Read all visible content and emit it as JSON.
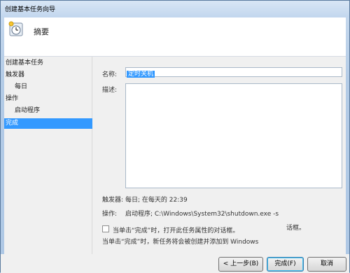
{
  "window": {
    "title": "创建基本任务向导"
  },
  "header": {
    "heading": "摘要"
  },
  "nav": {
    "items": [
      {
        "label": "创建基本任务",
        "indent": false,
        "active": false
      },
      {
        "label": "触发器",
        "indent": false,
        "active": false
      },
      {
        "label": "每日",
        "indent": true,
        "active": false
      },
      {
        "label": "操作",
        "indent": false,
        "active": false
      },
      {
        "label": "启动程序",
        "indent": true,
        "active": false
      },
      {
        "label": "完成",
        "indent": false,
        "active": true
      }
    ]
  },
  "form": {
    "name_label": "名称:",
    "name_value": "定时关机",
    "desc_label": "描述:",
    "desc_value": "",
    "trigger_label": "触发器:",
    "trigger_value": "每日; 在每天的 22:39",
    "action_label": "操作:",
    "action_value": "启动程序; C:\\Windows\\System32\\shutdown.exe -s",
    "open_props_label": "当单击“完成”时，打开此任务属性的对话框。",
    "open_props_suffix": "话框。",
    "open_props_checked": false,
    "info_text": "当单击“完成”时，新任务将会被创建并添加到 Windows"
  },
  "buttons": {
    "back": "< 上一步(B)",
    "finish": "完成(F)",
    "cancel": "取消"
  }
}
